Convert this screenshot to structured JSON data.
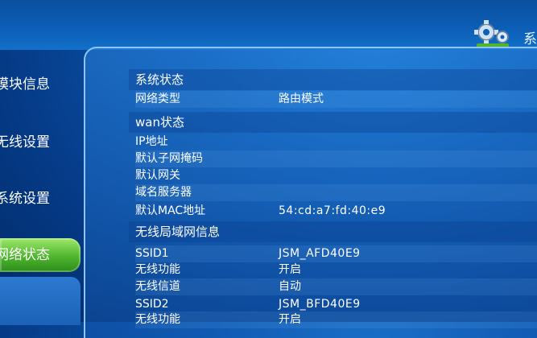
{
  "header": {
    "title": "系",
    "logo_icon": "gear-cluster-icon"
  },
  "sidebar": {
    "items": [
      {
        "label": "模块信息"
      },
      {
        "label": "无线设置"
      },
      {
        "label": "系统设置"
      },
      {
        "label": "网络状态"
      }
    ],
    "active_index": 3,
    "active_color": "#4fb52e"
  },
  "sections": {
    "system": {
      "title": "系统状态",
      "rows": [
        {
          "label": "网络类型",
          "value": "路由模式"
        }
      ]
    },
    "wan": {
      "title": "wan状态",
      "rows": [
        {
          "label": "IP地址",
          "value": ""
        },
        {
          "label": "默认子网掩码",
          "value": ""
        },
        {
          "label": "默认网关",
          "value": ""
        },
        {
          "label": "域名服务器",
          "value": ""
        },
        {
          "label": "默认MAC地址",
          "value": "54:cd:a7:fd:40:e9"
        }
      ]
    },
    "wlan": {
      "title": "无线局域网信息",
      "rows": [
        {
          "label": "SSID1",
          "value": "JSM_AFD40E9"
        },
        {
          "label": "无线功能",
          "value": "开启"
        },
        {
          "label": "无线信道",
          "value": "自动"
        },
        {
          "label": "SSID2",
          "value": "JSM_BFD40E9"
        },
        {
          "label": "无线功能",
          "value": "开启"
        }
      ]
    }
  }
}
